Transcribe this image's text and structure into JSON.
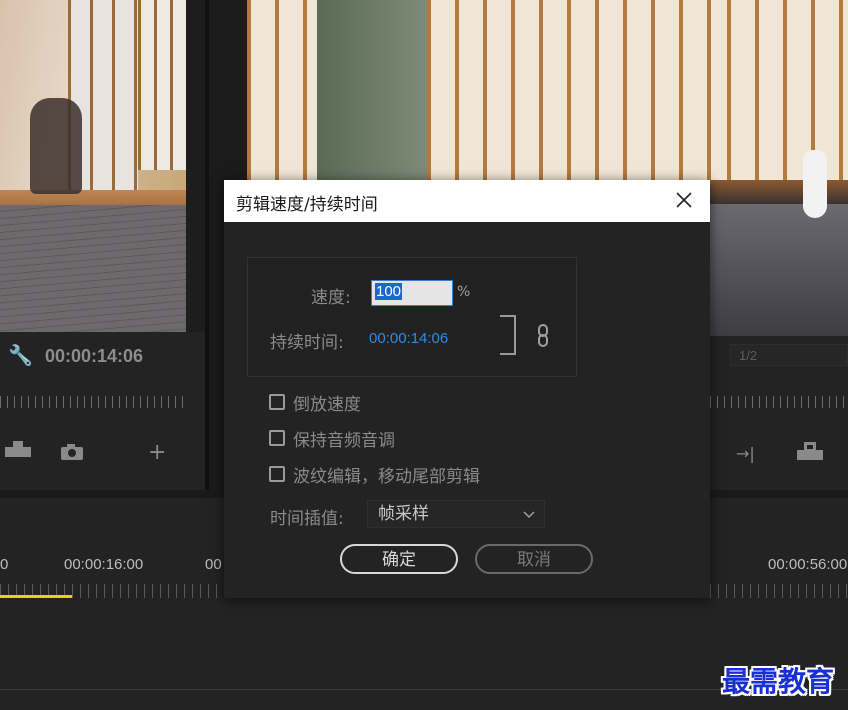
{
  "source_monitor": {
    "timecode": "00:00:14:06"
  },
  "program_monitor": {
    "page_select": "1/2"
  },
  "timeline": {
    "time_labels": [
      "0",
      "00:00:16:00",
      "00",
      "00:00:56:00"
    ]
  },
  "dialog": {
    "title": "剪辑速度/持续时间",
    "speed_label": "速度:",
    "speed_value": "100",
    "speed_unit": "%",
    "duration_label": "持续时间:",
    "duration_value": "00:00:14:06",
    "checkboxes": [
      {
        "label": "倒放速度",
        "checked": false
      },
      {
        "label": "保持音频音调",
        "checked": false
      },
      {
        "label": "波纹编辑，移动尾部剪辑",
        "checked": false
      }
    ],
    "interp_label": "时间插值:",
    "interp_value": "帧采样",
    "ok_label": "确定",
    "cancel_label": "取消"
  },
  "watermark": "最需教育",
  "colors": {
    "accent_blue": "#2f8ce6",
    "dialog_bg": "#232323",
    "playhead_range": "#e5d600"
  }
}
